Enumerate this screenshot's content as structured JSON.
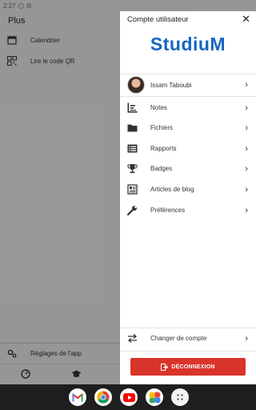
{
  "status_bar": {
    "time": "2:27"
  },
  "background_app": {
    "title": "Plus",
    "items": [
      {
        "label": "Calendrier",
        "icon": "calendar-icon"
      },
      {
        "label": "Lire le code QR",
        "icon": "qr-code-icon"
      }
    ],
    "footer_item": {
      "label": "Réglages de l'app",
      "icon": "settings-gear-icon"
    },
    "bottom_nav": [
      {
        "icon": "dashboard-icon"
      },
      {
        "icon": "graduation-cap-icon"
      }
    ]
  },
  "drawer": {
    "title": "Compte utilisateur",
    "brand": "StudiuM",
    "user": {
      "name": "Issam Taboubi"
    },
    "items": [
      {
        "label": "Notes",
        "icon": "grades-chart-icon"
      },
      {
        "label": "Fichiers",
        "icon": "folder-icon"
      },
      {
        "label": "Rapports",
        "icon": "list-icon"
      },
      {
        "label": "Badges",
        "icon": "trophy-icon"
      },
      {
        "label": "Articles de blog",
        "icon": "newspaper-icon"
      },
      {
        "label": "Préférences",
        "icon": "wrench-icon"
      }
    ],
    "change_account": {
      "label": "Changer de compte",
      "icon": "swap-arrows-icon"
    },
    "logout_label": "DÉCONNEXION",
    "colors": {
      "brand": "#1565c0",
      "logout": "#d9342b"
    }
  },
  "dock": {
    "apps": [
      "gmail-icon",
      "chrome-icon",
      "youtube-icon",
      "photos-icon",
      "app-drawer-icon"
    ]
  }
}
